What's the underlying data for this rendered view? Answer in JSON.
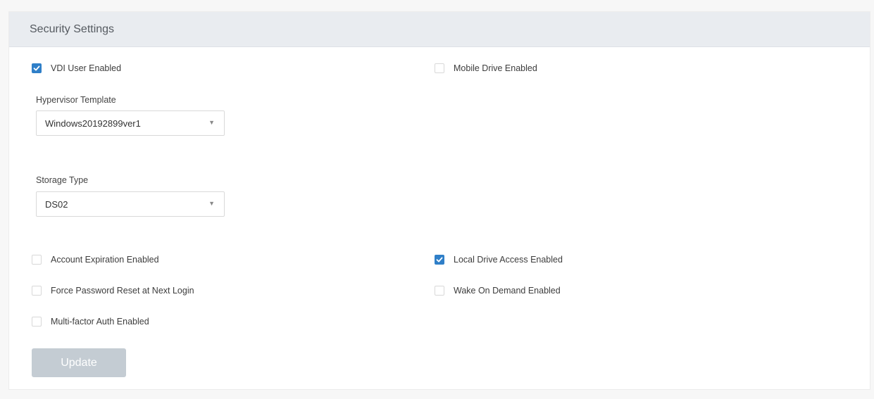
{
  "panel": {
    "title": "Security Settings"
  },
  "checkboxes": {
    "vdi_user": {
      "label": "VDI User Enabled",
      "checked": true
    },
    "mobile_drive": {
      "label": "Mobile Drive Enabled",
      "checked": false
    },
    "account_expiration": {
      "label": "Account Expiration Enabled",
      "checked": false
    },
    "local_drive_access": {
      "label": "Local Drive Access Enabled",
      "checked": true
    },
    "force_password_reset": {
      "label": "Force Password Reset at Next Login",
      "checked": false
    },
    "wake_on_demand": {
      "label": "Wake On Demand Enabled",
      "checked": false
    },
    "multi_factor": {
      "label": "Multi-factor Auth Enabled",
      "checked": false
    }
  },
  "hypervisor": {
    "label": "Hypervisor Template",
    "value": "Windows20192899ver1"
  },
  "storage": {
    "label": "Storage Type",
    "value": "DS02"
  },
  "update_button": {
    "label": "Update",
    "disabled": true
  },
  "icons": {
    "check": "check-icon",
    "caret": "caret-down-icon"
  },
  "colors": {
    "accent": "#2f7fc8",
    "header_bg": "#e9ecf0",
    "button_disabled": "#c4ccd3"
  }
}
